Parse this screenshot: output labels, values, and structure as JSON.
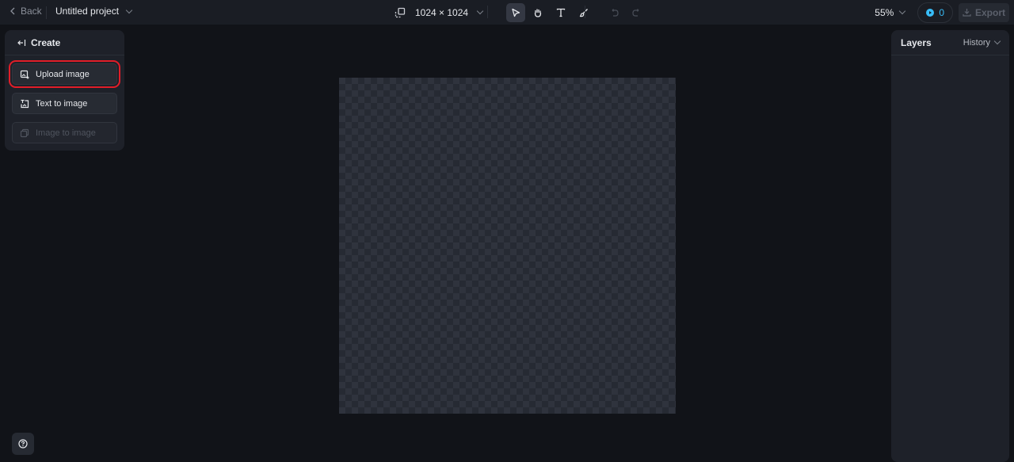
{
  "topbar": {
    "back_label": "Back",
    "project_title": "Untitled project",
    "canvas_size": "1024 × 1024",
    "tools": [
      {
        "name": "select-tool",
        "icon": "cursor-arrow-icon",
        "active": true
      },
      {
        "name": "hand-tool",
        "icon": "hand-icon",
        "active": false
      },
      {
        "name": "text-tool",
        "icon": "text-icon",
        "active": false
      },
      {
        "name": "brush-tool",
        "icon": "brush-icon",
        "active": false
      }
    ],
    "undo_icon": "undo-icon",
    "redo_icon": "redo-icon",
    "zoom_level": "55%",
    "credits": "0",
    "export_label": "Export"
  },
  "left_panel": {
    "header": "Create",
    "buttons": [
      {
        "label": "Upload image",
        "icon": "upload-image-icon",
        "enabled": true,
        "highlighted": true
      },
      {
        "label": "Text to image",
        "icon": "text-to-image-icon",
        "enabled": true,
        "highlighted": false
      },
      {
        "label": "Image to image",
        "icon": "image-to-image-icon",
        "enabled": false,
        "highlighted": false
      }
    ]
  },
  "right_panel": {
    "title": "Layers",
    "history_label": "History"
  },
  "colors": {
    "accent_credits": "#38bdf8",
    "highlight_border": "#e11d28",
    "background": "#111318",
    "panel": "#1e2129"
  }
}
